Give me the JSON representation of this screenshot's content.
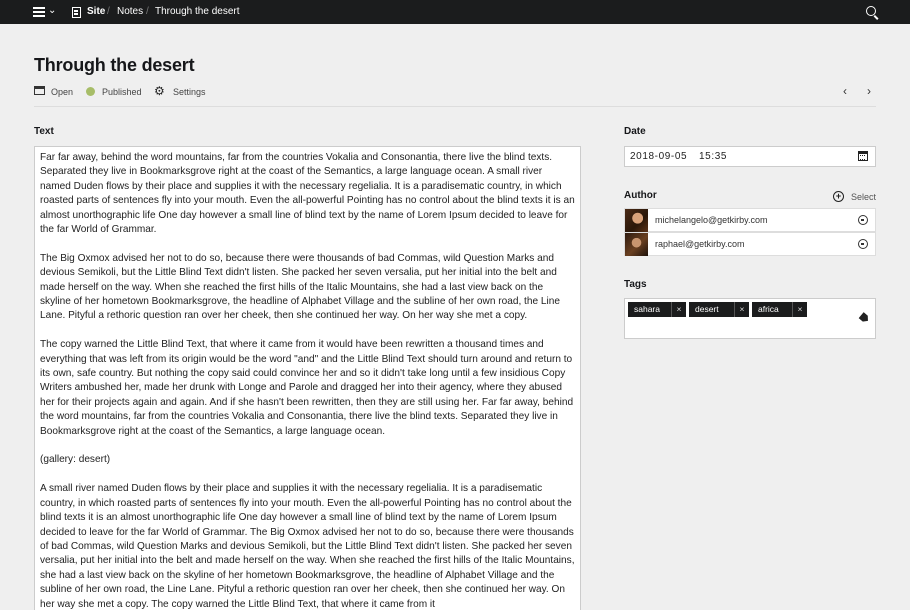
{
  "topbar": {
    "site_label": "Site",
    "breadcrumbs": [
      "Notes",
      "Through the desert"
    ],
    "separator": "/"
  },
  "page": {
    "title": "Through the desert",
    "actions": {
      "open": "Open",
      "status": "Published",
      "settings": "Settings"
    }
  },
  "text_field": {
    "label": "Text",
    "paragraphs": [
      "Far far away, behind the word mountains, far from the countries Vokalia and Consonantia, there live the blind texts. Separated they live in Bookmarksgrove right at the coast of the Semantics, a large language ocean. A small river named Duden flows by their place and supplies it with the necessary regelialia. It is a paradisematic country, in which roasted parts of sentences fly into your mouth. Even the all-powerful Pointing has no control about the blind texts it is an almost unorthographic life One day however a small line of blind text by the name of Lorem Ipsum decided to leave for the far World of Grammar.",
      "The Big Oxmox advised her not to do so, because there were thousands of bad Commas, wild Question Marks and devious Semikoli, but the Little Blind Text didn't listen. She packed her seven versalia, put her initial into the belt and made herself on the way. When she reached the first hills of the Italic Mountains, she had a last view back on the skyline of her hometown Bookmarksgrove, the headline of Alphabet Village and the subline of her own road, the Line Lane. Pityful a rethoric question ran over her cheek, then she continued her way. On her way she met a copy.",
      "The copy warned the Little Blind Text, that where it came from it would have been rewritten a thousand times and everything that was left from its origin would be the word \"and\" and the Little Blind Text should turn around and return to its own, safe country. But nothing the copy said could convince her and so it didn't take long until a few insidious Copy Writers ambushed her, made her drunk with Longe and Parole and dragged her into their agency, where they abused her for their projects again and again. And if she hasn't been rewritten, then they are still using her. Far far away, behind the word mountains, far from the countries Vokalia and Consonantia, there live the blind texts. Separated they live in Bookmarksgrove right at the coast of the Semantics, a large language ocean.",
      "(gallery: desert)",
      "A small river named Duden flows by their place and supplies it with the necessary regelialia. It is a paradisematic country, in which roasted parts of sentences fly into your mouth. Even the all-powerful Pointing has no control about the blind texts it is an almost unorthographic life One day however a small line of blind text by the name of Lorem Ipsum decided to leave for the far World of Grammar. The Big Oxmox advised her not to do so, because there were thousands of bad Commas, wild Question Marks and devious Semikoli, but the Little Blind Text didn't listen. She packed her seven versalia, put her initial into the belt and made herself on the way. When she reached the first hills of the Italic Mountains, she had a last view back on the skyline of her hometown Bookmarksgrove, the headline of Alphabet Village and the subline of her own road, the Line Lane. Pityful a rethoric question ran over her cheek, then she continued her way. On her way she met a copy. The copy warned the Little Blind Text, that where it came from it"
    ]
  },
  "date_field": {
    "label": "Date",
    "date": "2018-09-05",
    "time": "15:35"
  },
  "author_field": {
    "label": "Author",
    "select_label": "Select",
    "authors": [
      {
        "email": "michelangelo@getkirby.com"
      },
      {
        "email": "raphael@getkirby.com"
      }
    ]
  },
  "tags_field": {
    "label": "Tags",
    "remove_glyph": "×",
    "tags": [
      "sahara",
      "desert",
      "africa"
    ]
  },
  "colors": {
    "topbar": "#1b1c1d",
    "published": "#a7bd68",
    "background": "#efefef"
  }
}
